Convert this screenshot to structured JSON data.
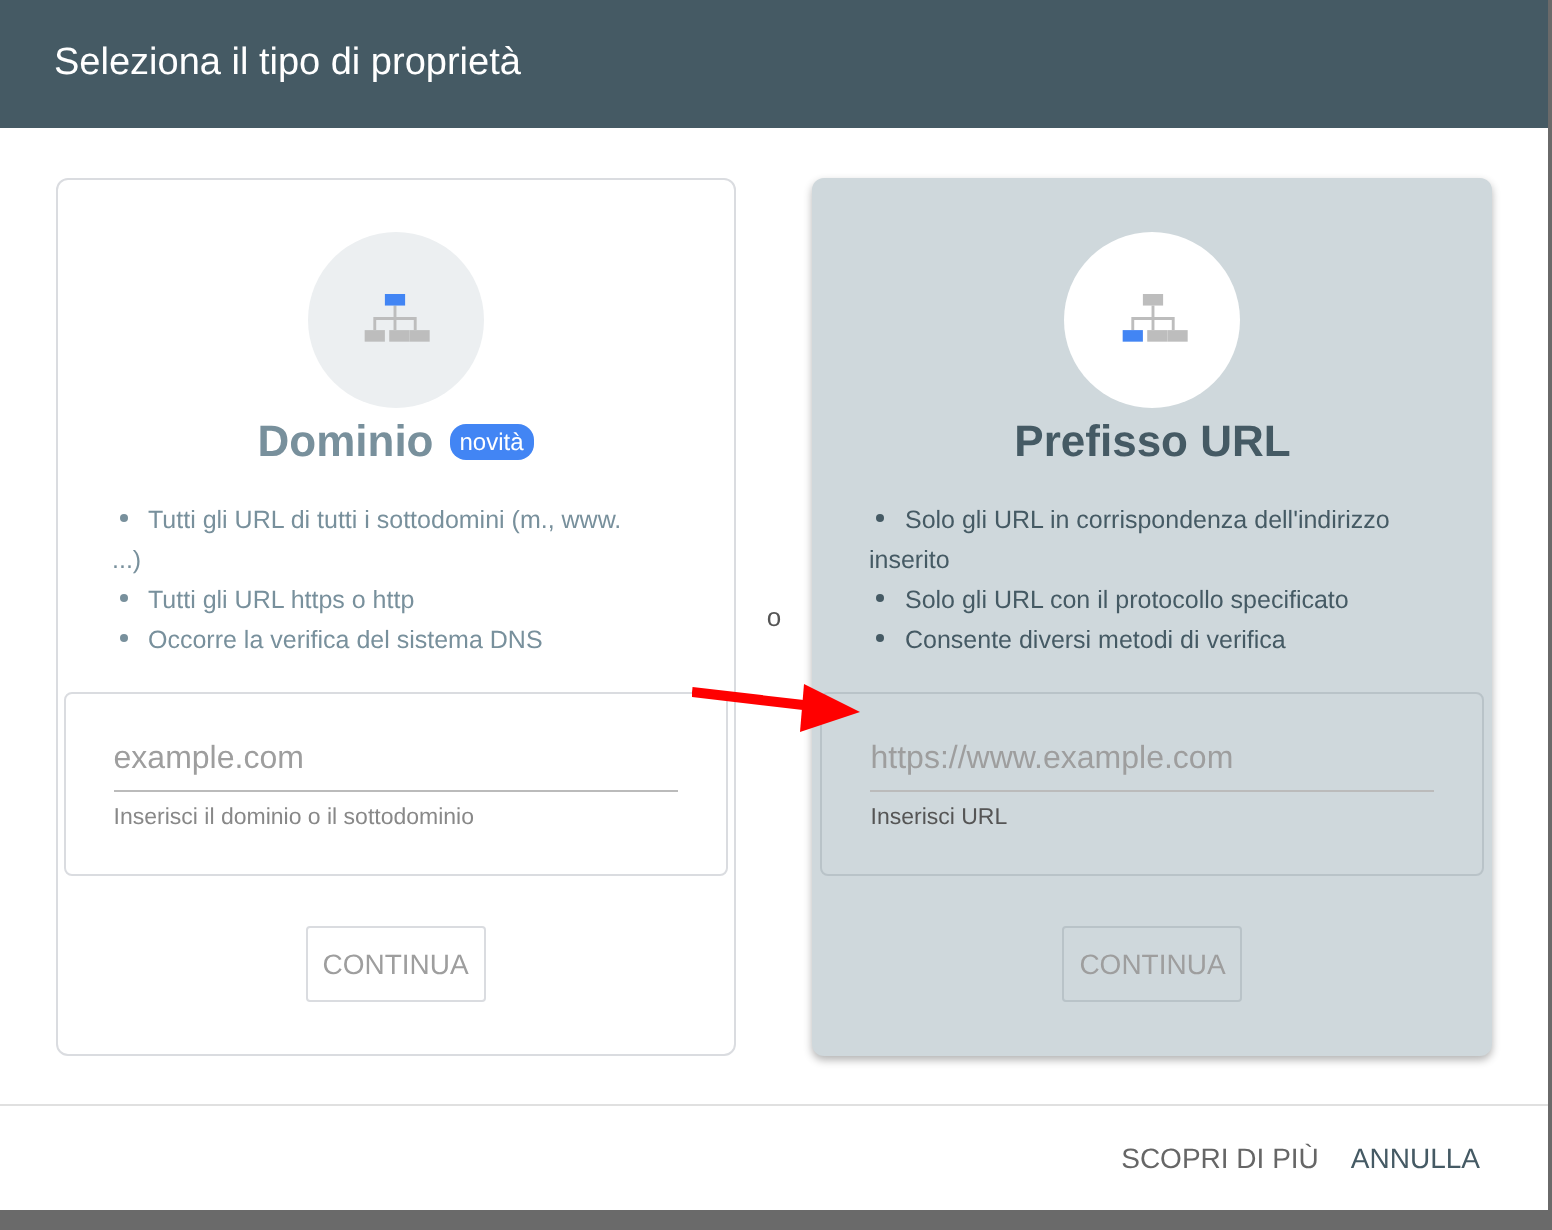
{
  "dialog": {
    "title": "Seleziona il tipo di proprietà"
  },
  "cards": [
    {
      "kind": "domain",
      "selected": false,
      "title": "Dominio",
      "badge": "novità",
      "bullets": [
        "Tutti gli URL di tutti i sottodomini (m., www. ...)",
        "Tutti gli URL https o http",
        "Occorre la verifica del sistema DNS"
      ],
      "field": {
        "placeholder": "example.com",
        "helper": "Inserisci il dominio o il sottodominio"
      },
      "button": {
        "label": "CONTINUA",
        "disabled": true
      }
    },
    {
      "kind": "prefix",
      "selected": true,
      "title": "Prefisso URL",
      "bullets": [
        "Solo gli URL in corrispondenza dell'indirizzo inserito",
        "Solo gli URL con il protocollo specificato",
        "Consente diversi metodi di verifica"
      ],
      "field": {
        "placeholder": "https://www.example.com",
        "helper": "Inserisci URL"
      },
      "button": {
        "label": "CONTINUA",
        "disabled": true
      }
    }
  ],
  "separator": "o",
  "footer": {
    "buttons": [
      {
        "label": "SCOPRI DI PIÙ",
        "primary": false
      },
      {
        "label": "ANNULLA",
        "primary": true
      }
    ]
  }
}
